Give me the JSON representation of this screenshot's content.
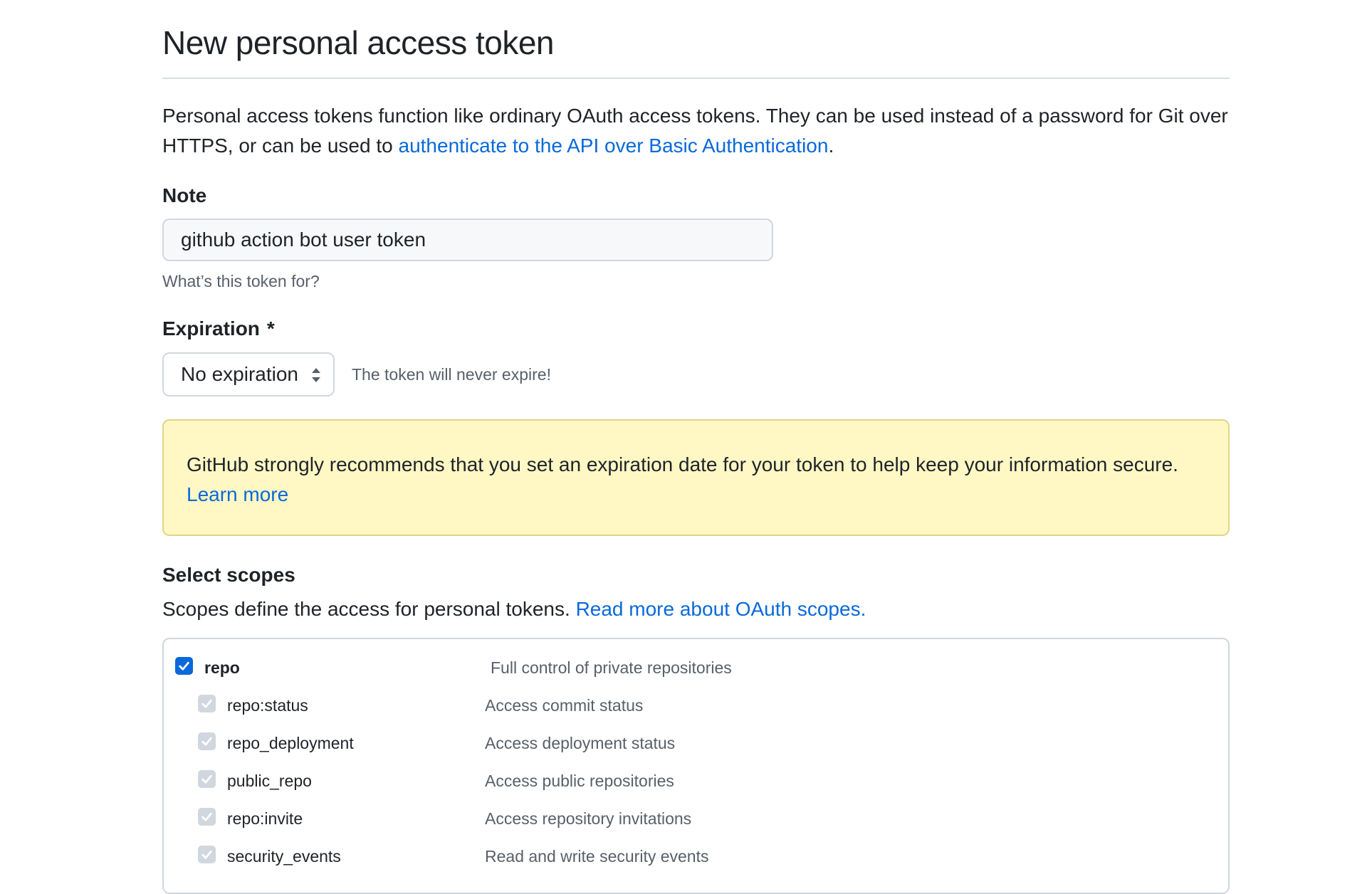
{
  "page": {
    "title": "New personal access token",
    "intro_text": "Personal access tokens function like ordinary OAuth access tokens. They can be used instead of a password for Git over HTTPS, or can be used to ",
    "intro_link": "authenticate to the API over Basic Authentication",
    "intro_end": "."
  },
  "note": {
    "label": "Note",
    "value": "github action bot user token",
    "hint": "What’s this token for?"
  },
  "expiration": {
    "label": "Expiration",
    "required_marker": "*",
    "selected": "No expiration",
    "hint": "The token will never expire!"
  },
  "warning": {
    "text": "GitHub strongly recommends that you set an expiration date for your token to help keep your information secure.",
    "link": "Learn more",
    "background": "#fff8c5"
  },
  "scopes": {
    "heading": "Select scopes",
    "description": "Scopes define the access for personal tokens. ",
    "link": "Read more about OAuth scopes.",
    "items": [
      {
        "name": "repo",
        "description": "Full control of private repositories",
        "checked": true,
        "level": "parent"
      },
      {
        "name": "repo:status",
        "description": "Access commit status",
        "checked": true,
        "level": "child"
      },
      {
        "name": "repo_deployment",
        "description": "Access deployment status",
        "checked": true,
        "level": "child"
      },
      {
        "name": "public_repo",
        "description": "Access public repositories",
        "checked": true,
        "level": "child"
      },
      {
        "name": "repo:invite",
        "description": "Access repository invitations",
        "checked": true,
        "level": "child"
      },
      {
        "name": "security_events",
        "description": "Read and write security events",
        "checked": true,
        "level": "child"
      }
    ]
  },
  "colors": {
    "link": "#0969da",
    "checkbox_checked": "#0969da",
    "checkbox_disabled": "#d0d7de",
    "muted_text": "#57606a"
  }
}
